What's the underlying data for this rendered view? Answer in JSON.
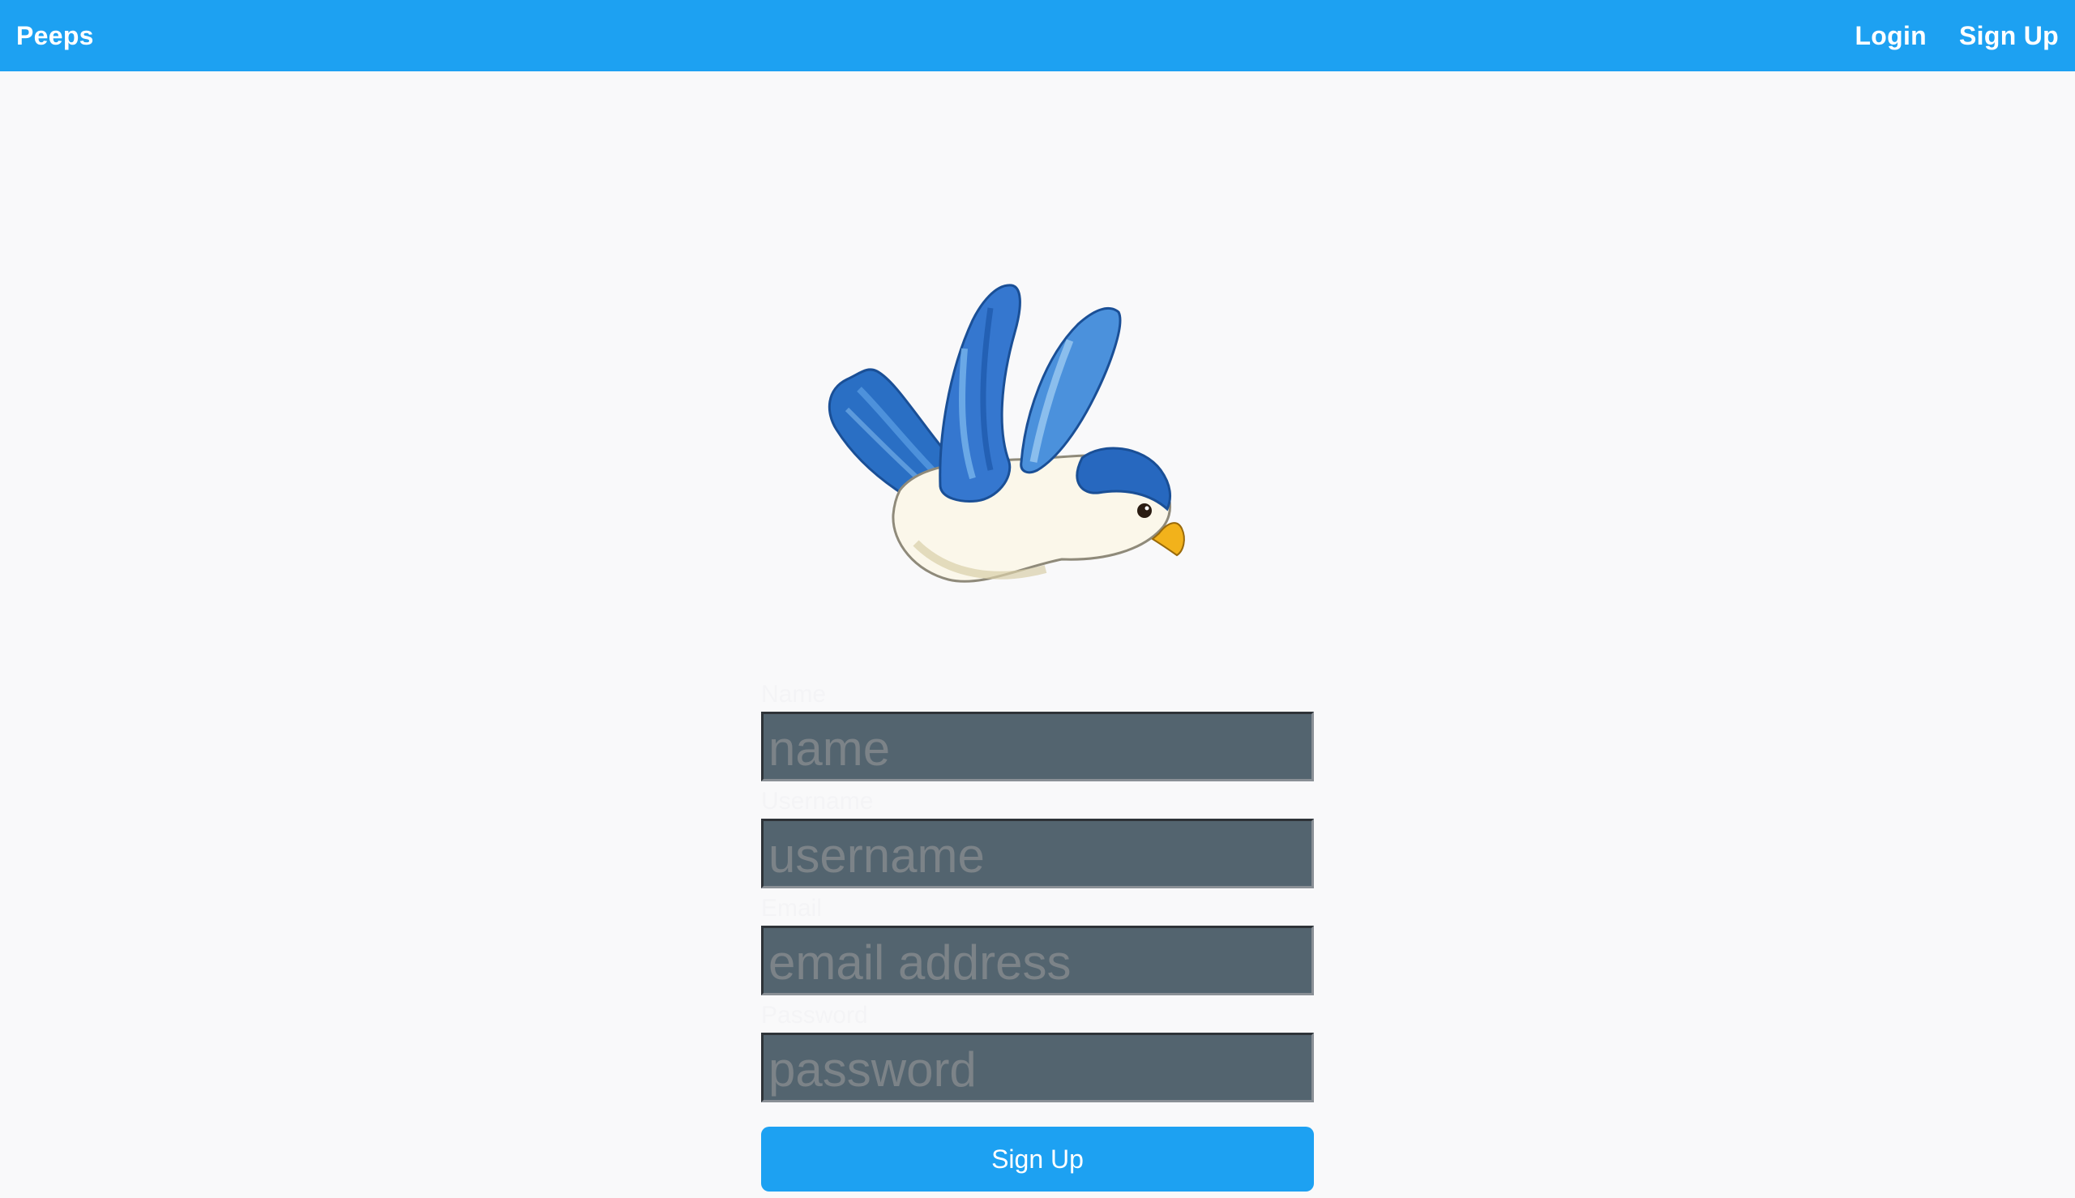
{
  "navbar": {
    "brand": "Peeps",
    "links": [
      {
        "label": "Login"
      },
      {
        "label": "Sign Up"
      }
    ]
  },
  "logo": {
    "icon": "bluebird-icon",
    "colors": {
      "wing_dark": "#1f5fb8",
      "wing_mid": "#3a86d8",
      "wing_light": "#7fb8ec",
      "body": "#fbf7ea",
      "beak": "#f2b21b",
      "eye": "#2a1c12"
    }
  },
  "form": {
    "fields": [
      {
        "label": "Name",
        "placeholder": "name",
        "value": ""
      },
      {
        "label": "Username",
        "placeholder": "username",
        "value": ""
      },
      {
        "label": "Email",
        "placeholder": "email address",
        "value": ""
      },
      {
        "label": "Password",
        "placeholder": "password",
        "value": ""
      }
    ],
    "submit_label": "Sign Up"
  },
  "theme": {
    "accent": "#1da1f2",
    "page_bg": "#f9f9fa",
    "input_bg": "#53646f"
  }
}
